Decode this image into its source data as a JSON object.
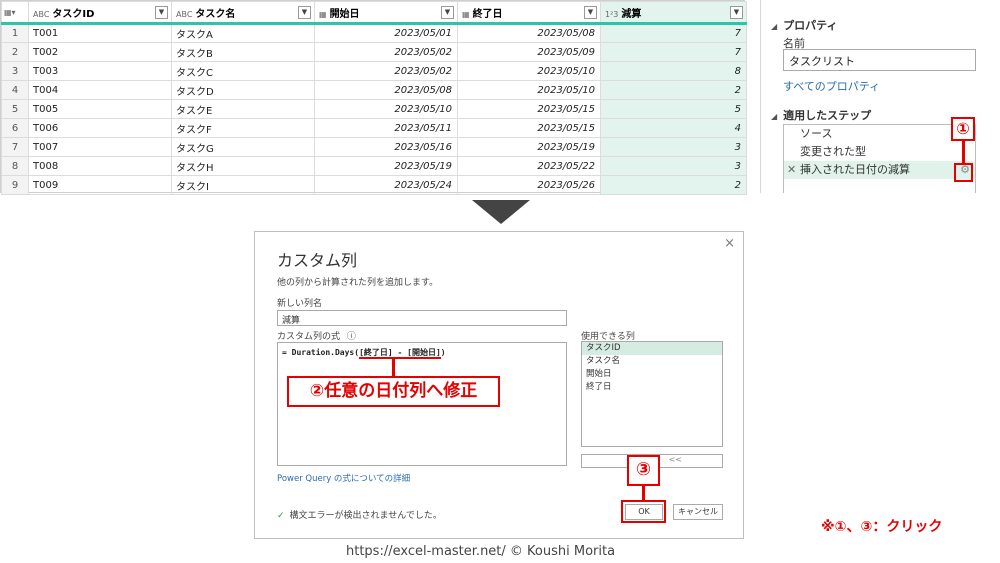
{
  "grid": {
    "headers": [
      {
        "icon": "ABC",
        "label": "タスクID"
      },
      {
        "icon": "ABC",
        "label": "タスク名"
      },
      {
        "icon": "▦",
        "label": "開始日"
      },
      {
        "icon": "▦",
        "label": "終了日"
      },
      {
        "icon": "1²3",
        "label": "減算"
      }
    ],
    "rows": [
      [
        "1",
        "T001",
        "タスクA",
        "2023/05/01",
        "2023/05/08",
        "7"
      ],
      [
        "2",
        "T002",
        "タスクB",
        "2023/05/02",
        "2023/05/09",
        "7"
      ],
      [
        "3",
        "T003",
        "タスクC",
        "2023/05/02",
        "2023/05/10",
        "8"
      ],
      [
        "4",
        "T004",
        "タスクD",
        "2023/05/08",
        "2023/05/10",
        "2"
      ],
      [
        "5",
        "T005",
        "タスクE",
        "2023/05/10",
        "2023/05/15",
        "5"
      ],
      [
        "6",
        "T006",
        "タスクF",
        "2023/05/11",
        "2023/05/15",
        "4"
      ],
      [
        "7",
        "T007",
        "タスクG",
        "2023/05/16",
        "2023/05/19",
        "3"
      ],
      [
        "8",
        "T008",
        "タスクH",
        "2023/05/19",
        "2023/05/22",
        "3"
      ],
      [
        "9",
        "T009",
        "タスクI",
        "2023/05/24",
        "2023/05/26",
        "2"
      ]
    ]
  },
  "panel": {
    "properties_title": "プロパティ",
    "name_label": "名前",
    "name_value": "タスクリスト",
    "all_properties_link": "すべてのプロパティ",
    "steps_title": "適用したステップ",
    "steps": [
      "ソース",
      "変更された型",
      "挿入された日付の減算"
    ],
    "active_step_index": 2
  },
  "annotations": {
    "step1_badge": "①",
    "step2_callout": "②任意の日付列へ修正",
    "step3_badge": "③",
    "note": "※①、③：クリック",
    "credit": "https://excel-master.net/  © Koushi Morita"
  },
  "dialog": {
    "title": "カスタム列",
    "subtitle": "他の列から計算された列を追加します。",
    "new_col_label": "新しい列名",
    "new_col_value": "減算",
    "formula_label": "カスタム列の式",
    "formula_prefix": "= Duration.Days(",
    "formula_highlight": "[終了日] - [開始日]",
    "formula_suffix": ")",
    "available_label": "使用できる列",
    "available_cols": [
      "タスクID",
      "タスク名",
      "開始日",
      "終了日"
    ],
    "insert_label": "<<",
    "help_link": "Power Query の式についての詳細",
    "status_text": "構文エラーが検出されませんでした。",
    "ok_label": "OK",
    "cancel_label": "キャンセル",
    "close_glyph": "×",
    "info_glyph": "ⓘ"
  },
  "colors": {
    "accent_green": "#2ec4a9",
    "highlight_red": "#e60000",
    "link_blue": "#2a6cb0"
  }
}
